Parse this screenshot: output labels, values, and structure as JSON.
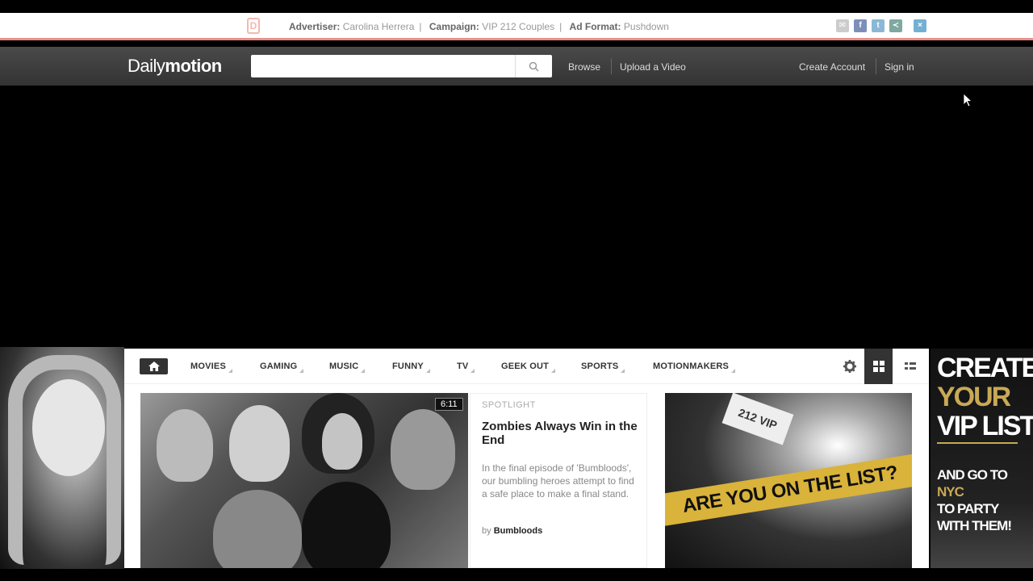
{
  "adbar": {
    "logo_letter": "D",
    "advertiser_label": "Advertiser:",
    "advertiser_value": "Carolina Herrera",
    "campaign_label": "Campaign:",
    "campaign_value": "VIP 212 Couples",
    "format_label": "Ad Format:",
    "format_value": "Pushdown",
    "social": [
      "mail-icon",
      "facebook-icon",
      "twitter-icon",
      "share-icon",
      "close-icon"
    ]
  },
  "navbar": {
    "brand_light": "Daily",
    "brand_bold": "motion",
    "search_placeholder": "",
    "browse": "Browse",
    "upload": "Upload a Video",
    "create_account": "Create Account",
    "sign_in": "Sign in"
  },
  "categories": [
    "MOVIES",
    "GAMING",
    "MUSIC",
    "FUNNY",
    "TV",
    "GEEK OUT",
    "SPORTS",
    "MOTIONMAKERS"
  ],
  "featured": {
    "duration": "6:11",
    "spotlight_label": "SPOTLIGHT",
    "title": "Zombies Always Win in the End",
    "description": "In the final episode of 'Bumbloods', our bumbling heroes attempt to find a safe place to make a final stand.",
    "by_prefix": "by",
    "author": "Bumbloods"
  },
  "ad_image": {
    "ticket_text": "212 VIP",
    "banner_text": "ARE YOU ON THE LIST?"
  },
  "right_ad": {
    "line1": "CREATE",
    "line2": "YOUR",
    "line3": "VIP LIST",
    "sub1": "AND GO TO ",
    "sub1_gold": "NYC",
    "sub2": "TO PARTY",
    "sub3": "WITH THEM!"
  },
  "colors": {
    "adbar_rule": "#e8908a",
    "gold": "#c8a955",
    "banner_yellow": "#d9b33a",
    "nav_bg": "#3a3a3a"
  }
}
